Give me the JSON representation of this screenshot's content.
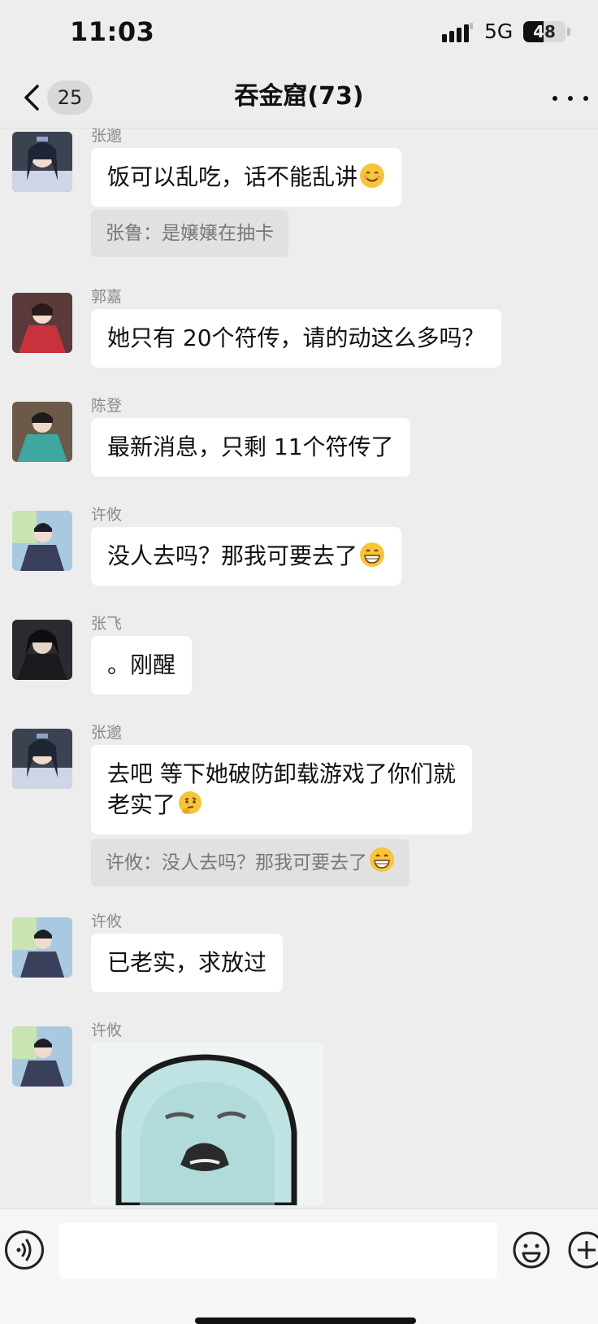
{
  "status_bar": {
    "time": "11:03",
    "network": "5G",
    "battery": "48",
    "battery_level": 0.48
  },
  "nav": {
    "unread_count": "25",
    "title": "吞金窟(73)"
  },
  "messages": [
    {
      "sender": "张邈",
      "text": "饭可以乱吃，话不能乱讲",
      "emoji": "smiling-face-emoji",
      "quote": "张鲁：是嬢嬢在抽卡"
    },
    {
      "sender": "郭嘉",
      "text": "她只有 20个符传，请的动这么多吗？"
    },
    {
      "sender": "陈登",
      "text": "最新消息，只剩 11个符传了"
    },
    {
      "sender": "许攸",
      "text": "没人去吗？那我可要去了",
      "emoji": "grinning-face-emoji"
    },
    {
      "sender": "张飞",
      "text": "。刚醒"
    },
    {
      "sender": "张邈",
      "text_line1": "去吧  等下她破防卸载游戏了你们就",
      "text_line2": "老实了",
      "emoji": "thinking-face-emoji",
      "quote": "许攸：没人去吗？那我可要去了",
      "quote_emoji": "grinning-face-emoji"
    },
    {
      "sender": "许攸",
      "text": "已老实，求放过"
    },
    {
      "sender": "许攸",
      "sticker": "meme-face-sticker"
    }
  ],
  "input": {
    "placeholder": ""
  },
  "colors": {
    "background": "#ededed",
    "bubble": "#ffffff",
    "quote_bg": "#e1e1e1",
    "sender_text": "#8a8a8a"
  },
  "icons": [
    "back-chevron-icon",
    "more-icon",
    "voice-icon",
    "emoji-icon",
    "plus-icon"
  ]
}
